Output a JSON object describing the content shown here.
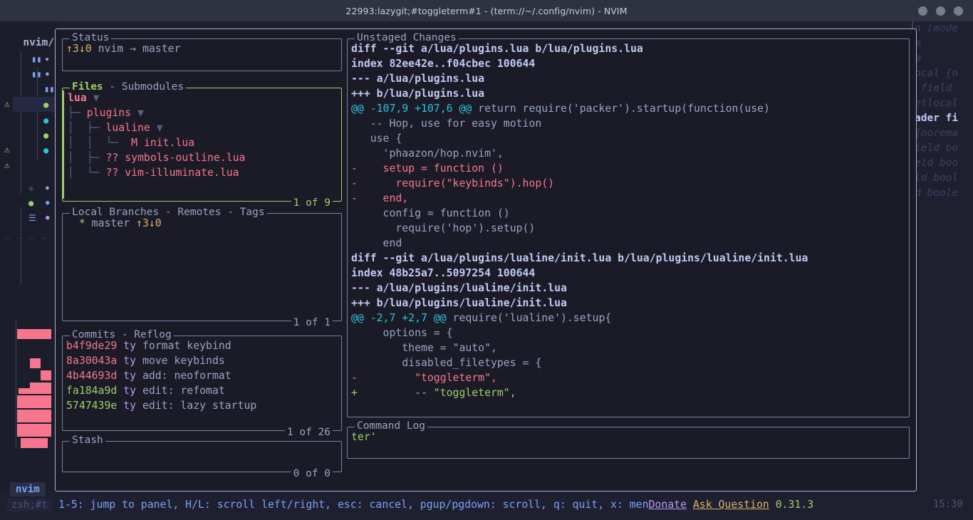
{
  "titlebar": {
    "title": "22993:lazygit;#toggleterm#1 - (term://~/.config/nvim) - NVIM",
    "buttons": [
      "minimize-dot",
      "maximize-dot",
      "close-dot"
    ]
  },
  "background": {
    "tree_title": "nvim/",
    "status_left": "nvim",
    "status_zsh": "zsh;#t",
    "clock": "15:30",
    "right_code_lines": [
      "n (mode",
      "m",
      "",
      "",
      "m",
      "ocal {n",
      " field",
      "etlocal",
      "ader fi",
      "{norema",
      "ield bo",
      "eld boo",
      "ld bool",
      "d boole"
    ],
    "bright_line_index": 8
  },
  "panels": {
    "status": {
      "title": "Status",
      "active": false,
      "ahead": "↑3",
      "behind": "↓0",
      "repo": "nvim",
      "arrow": "→",
      "branch": "master"
    },
    "files": {
      "title_active": "Files",
      "title_rest": " - Submodules",
      "active": true,
      "count": "1 of 9",
      "rows": [
        {
          "indent": "",
          "status": "",
          "name": "lua",
          "chevron": "▼",
          "kind": "dir-selected"
        },
        {
          "indent": "├─ ",
          "status": "",
          "name": "plugins",
          "chevron": "▼",
          "kind": "dir"
        },
        {
          "indent": "│  ├─ ",
          "status": "",
          "name": "lualine",
          "chevron": "▼",
          "kind": "dir"
        },
        {
          "indent": "│  │  └─ ",
          "status": " M",
          "name": "init.lua",
          "chevron": "",
          "kind": "file"
        },
        {
          "indent": "│  ├─ ",
          "status": "??",
          "name": "symbols-outline.lua",
          "chevron": "",
          "kind": "file"
        },
        {
          "indent": "│  └─ ",
          "status": "??",
          "name": "vim-illuminate.lua",
          "chevron": "",
          "kind": "file"
        }
      ]
    },
    "branches": {
      "title": "Local Branches - Remotes - Tags",
      "active": false,
      "count": "1 of 1",
      "rows": [
        {
          "marker": "*",
          "name": "master",
          "ahead": "↑3",
          "behind": "↓0"
        }
      ]
    },
    "commits": {
      "title": "Commits - Reflog",
      "active": false,
      "count": "1 of 26",
      "rows": [
        {
          "hash": "b4f9de29",
          "hash_color": "#f7768e",
          "author": "ty",
          "subject": "format keybind"
        },
        {
          "hash": "8a30043a",
          "hash_color": "#f7768e",
          "author": "ty",
          "subject": "move keybinds"
        },
        {
          "hash": "4b44693d",
          "hash_color": "#f7768e",
          "author": "ty",
          "subject": "add: neoformat"
        },
        {
          "hash": "fa184a9d",
          "hash_color": "#9ece6a",
          "author": "ty",
          "subject": "edit: refomat"
        },
        {
          "hash": "5747439e",
          "hash_color": "#9ece6a",
          "author": "ty",
          "subject": "edit: lazy startup"
        }
      ]
    },
    "stash": {
      "title": "Stash",
      "active": false,
      "count": "0 of 0",
      "rows": []
    },
    "diff": {
      "title": "Unstaged Changes",
      "active": false,
      "lines": [
        {
          "type": "header",
          "text": "diff --git a/lua/plugins.lua b/lua/plugins.lua"
        },
        {
          "type": "header",
          "text": "index 82ee42e..f04cbec 100644"
        },
        {
          "type": "header",
          "text": "--- a/lua/plugins.lua"
        },
        {
          "type": "header",
          "text": "+++ b/lua/plugins.lua"
        },
        {
          "type": "hunk",
          "marker": "@@ -107,9 +107,6 @@",
          "text": " return require('packer').startup(function(use)"
        },
        {
          "type": "context",
          "text": "   -- Hop, use for easy motion"
        },
        {
          "type": "context",
          "text": "   use {"
        },
        {
          "type": "context",
          "text": "     'phaazon/hop.nvim',"
        },
        {
          "type": "del",
          "text": "-    setup = function ()"
        },
        {
          "type": "del",
          "text": "-      require(\"keybinds\").hop()"
        },
        {
          "type": "del",
          "text": "-    end,"
        },
        {
          "type": "context",
          "text": "     config = function ()"
        },
        {
          "type": "context",
          "text": "       require('hop').setup()"
        },
        {
          "type": "context",
          "text": "     end"
        },
        {
          "type": "header",
          "text": "diff --git a/lua/plugins/lualine/init.lua b/lua/plugins/lualine/init.lua"
        },
        {
          "type": "header",
          "text": "index 48b25a7..5097254 100644"
        },
        {
          "type": "header",
          "text": "--- a/lua/plugins/lualine/init.lua"
        },
        {
          "type": "header",
          "text": "+++ b/lua/plugins/lualine/init.lua"
        },
        {
          "type": "hunk",
          "marker": "@@ -2,7 +2,7 @@",
          "text": " require('lualine').setup{"
        },
        {
          "type": "context",
          "text": "     options = {"
        },
        {
          "type": "context",
          "text": "        theme = \"auto\","
        },
        {
          "type": "context",
          "text": "        disabled_filetypes = {"
        },
        {
          "type": "del",
          "text": "-         \"toggleterm\","
        },
        {
          "type": "add",
          "text": "+         -- \"toggleterm\","
        }
      ]
    },
    "command_log": {
      "title": "Command Log",
      "active": false,
      "lines": [
        "ter'"
      ]
    }
  },
  "optionsbar": {
    "keys": "1-5: jump to panel, H/L: scroll left/right, esc: cancel, pgup/pgdown: scroll, q: quit, x: men",
    "donate": "Donate",
    "ask": "Ask Question",
    "version": "0.31.3"
  }
}
